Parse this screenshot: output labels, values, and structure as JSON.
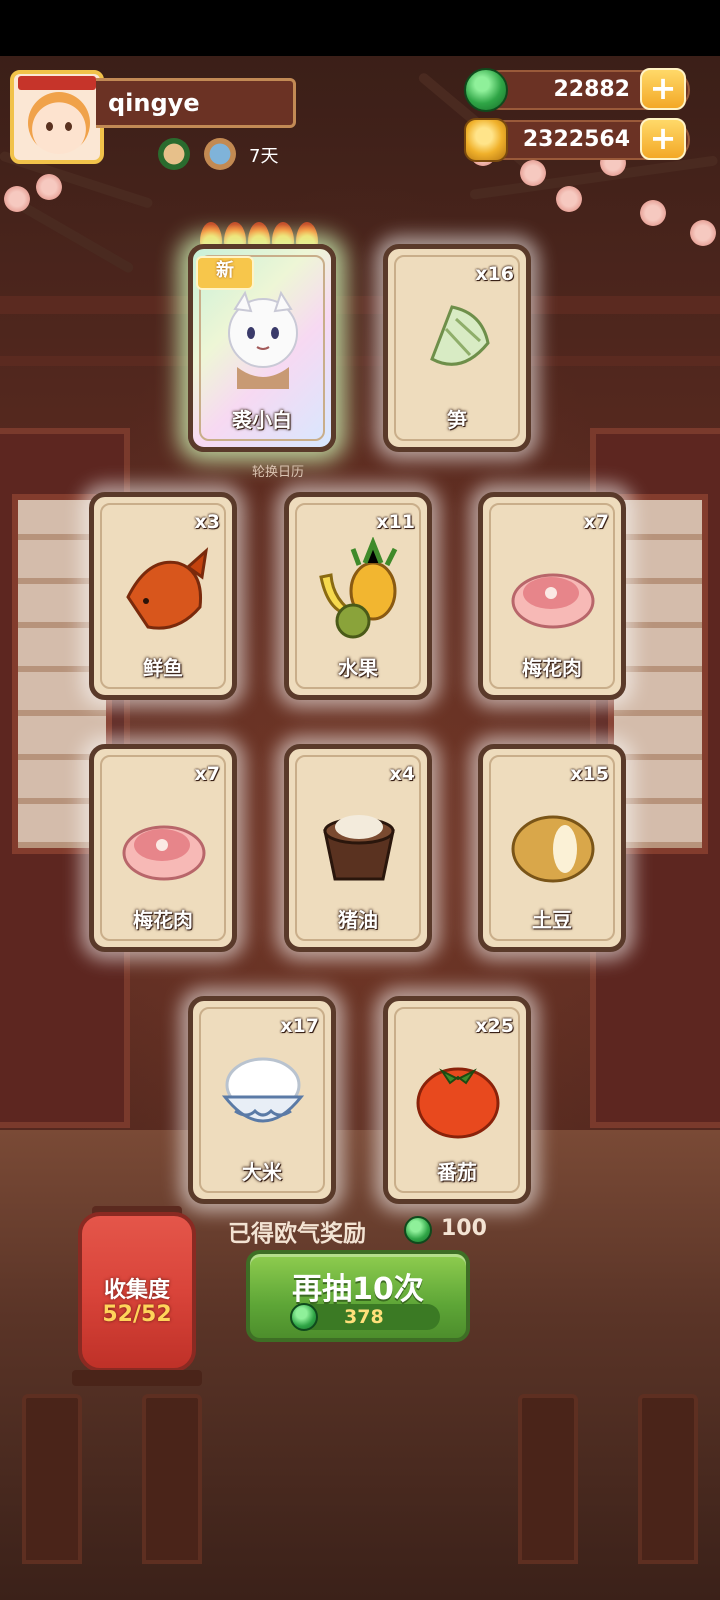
{
  "player": {
    "name": "qingye",
    "days": "7天"
  },
  "currency": {
    "jade": "22882",
    "coins": "2322564",
    "plus": "+"
  },
  "cards": [
    {
      "name": "裘小白",
      "count": "",
      "new_tag": "新",
      "art": "cat-character-icon",
      "rarity_flames": 5
    },
    {
      "name": "笋",
      "count": "x16",
      "art": "bamboo-shoot-icon"
    },
    {
      "name": "鲜鱼",
      "count": "x3",
      "art": "fish-icon"
    },
    {
      "name": "水果",
      "count": "x11",
      "art": "fruit-icon"
    },
    {
      "name": "梅花肉",
      "count": "x7",
      "art": "pork-icon"
    },
    {
      "name": "梅花肉",
      "count": "x7",
      "art": "pork-icon"
    },
    {
      "name": "猪油",
      "count": "x4",
      "art": "lard-icon"
    },
    {
      "name": "土豆",
      "count": "x15",
      "art": "potato-icon"
    },
    {
      "name": "大米",
      "count": "x17",
      "art": "rice-bowl-icon"
    },
    {
      "name": "番茄",
      "count": "x25",
      "art": "tomato-icon"
    }
  ],
  "caption": "轮换日历",
  "collection": {
    "title": "收集度",
    "value": "52/52"
  },
  "reward": {
    "label": "已得欧气奖励",
    "value": "100"
  },
  "draw": {
    "label": "再抽10次",
    "cost": "378"
  },
  "colors": {
    "card_bg": "#eedcbd",
    "card_border": "#5a3a2a",
    "button_green": "#5ea637",
    "lantern_red": "#d9443a",
    "gold": "#f3a826"
  }
}
